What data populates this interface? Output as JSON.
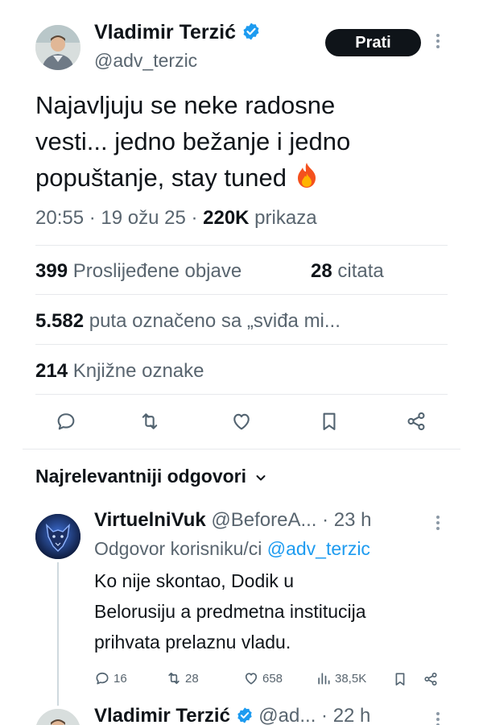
{
  "main_tweet": {
    "author_name": "Vladimir Terzić",
    "handle": "@adv_terzic",
    "follow_label": "Prati",
    "text_lines": [
      "Najavljuju se neke radosne",
      "vesti... jedno bežanje i jedno",
      "popuštanje, stay tuned"
    ],
    "emoji": "🔥",
    "time": "20:55 · 19 ožu 25 · ",
    "views_count": "220K",
    "views_label": " prikaza"
  },
  "stats": {
    "reposts_count": "399",
    "reposts_label": " Proslijeđene objave",
    "quotes_count": "28",
    "quotes_label": " citata",
    "likes_count": "5.582",
    "likes_label": " puta označeno sa „sviđa mi...",
    "bookmarks_count": "214",
    "bookmarks_label": " Knjižne oznake"
  },
  "actions": [
    "reply-icon",
    "repost-icon",
    "like-icon",
    "bookmark-icon",
    "share-icon"
  ],
  "replies_header": {
    "label": "Najrelevantniji odgovori"
  },
  "reply": {
    "author_name": "VirtuelniVuk",
    "handle_time": "@BeforeA... · 23 h",
    "replying_prefix": "Odgovor korisniku/ci ",
    "replying_handle": "@adv_terzic",
    "text_lines": [
      "Ko nije skontao, Dodik u",
      "Belorusiju a predmetna institucija",
      "prihvata prelaznu vladu."
    ],
    "reply_count": "16",
    "repost_count": "28",
    "like_count": "658",
    "views_count": "38,5K"
  },
  "next_reply": {
    "author_name": "Vladimir Terzić",
    "handle_time": "@ad... · 22 h"
  },
  "colors": {
    "accent": "#1d9bf0",
    "text": "#0f1419",
    "muted": "#59656f",
    "divider": "#e7e9ec"
  }
}
